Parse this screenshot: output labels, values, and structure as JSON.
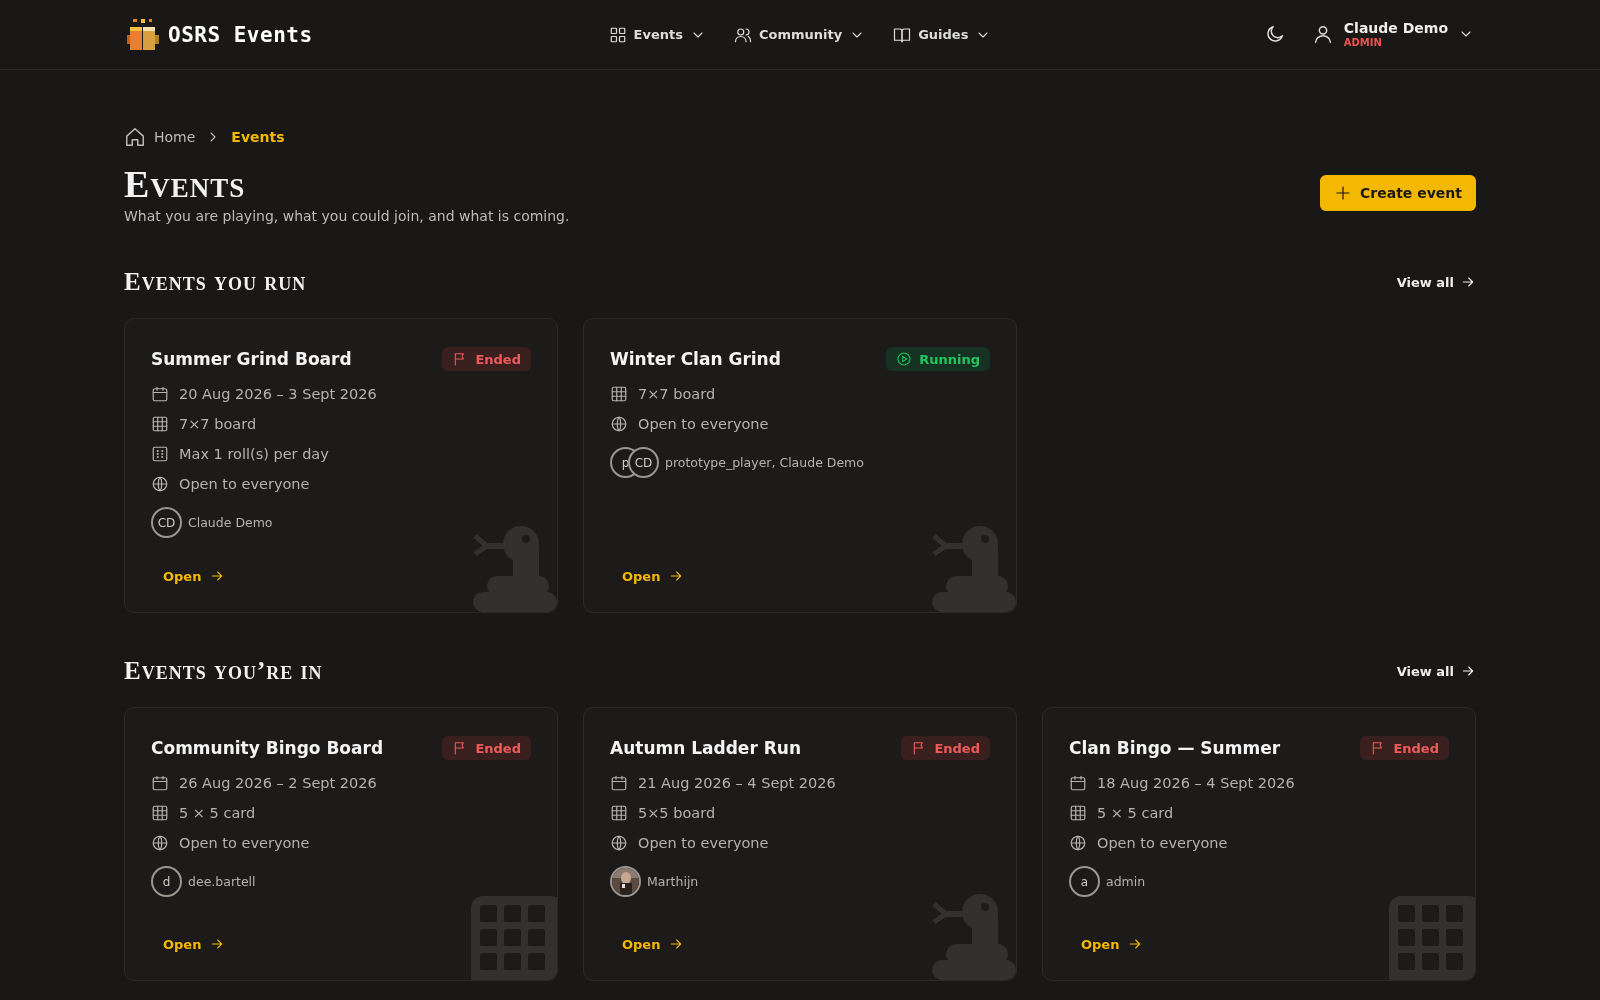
{
  "brand": {
    "name": "OSRS Events"
  },
  "nav": [
    {
      "label": "Events",
      "kind": "grid"
    },
    {
      "label": "Community",
      "kind": "users"
    },
    {
      "label": "Guides",
      "kind": "book"
    }
  ],
  "user": {
    "name": "Claude Demo",
    "role": "ADMIN"
  },
  "breadcrumb": [
    {
      "label": "Home",
      "selected": false
    },
    {
      "label": "Events",
      "selected": true
    }
  ],
  "page": {
    "title": "Events",
    "subtitle": "What you are playing, what you could join, and what is coming.",
    "action": "Create event"
  },
  "sections": [
    {
      "title": "Events you run",
      "link": "View all",
      "cards": [
        {
          "title": "Summer Grind Board",
          "status": {
            "kind": "ended",
            "label": "Ended"
          },
          "details": [
            {
              "kind": "date",
              "text": "20 Aug 2026 – 3 Sept 2026"
            },
            {
              "kind": "board",
              "text": "7×7 board"
            },
            {
              "kind": "rolls",
              "text": "Max 1 roll(s) per day"
            },
            {
              "kind": "access",
              "text": "Open to everyone"
            }
          ],
          "avatars": [
            {
              "kind": "initials",
              "text": "CD"
            }
          ],
          "people": "Claude Demo",
          "link": "Open",
          "art": {
            "kind": "snake"
          }
        },
        {
          "title": "Winter Clan Grind",
          "status": {
            "kind": "running",
            "label": "Running"
          },
          "details": [
            {
              "kind": "board",
              "text": "7×7 board"
            },
            {
              "kind": "access",
              "text": "Open to everyone"
            }
          ],
          "avatars": [
            {
              "kind": "initials",
              "text": "p"
            },
            {
              "kind": "initials",
              "text": "CD"
            }
          ],
          "people": "prototype_player, Claude Demo",
          "link": "Open",
          "art": {
            "kind": "snake"
          }
        }
      ]
    },
    {
      "title": "Events you’re in",
      "link": "View all",
      "cards": [
        {
          "title": "Community Bingo Board",
          "status": {
            "kind": "ended",
            "label": "Ended"
          },
          "details": [
            {
              "kind": "date",
              "text": "26 Aug 2026 – 2 Sept 2026"
            },
            {
              "kind": "board",
              "text": "5 × 5 card"
            },
            {
              "kind": "access",
              "text": "Open to everyone"
            }
          ],
          "avatars": [
            {
              "kind": "initials",
              "text": "d"
            }
          ],
          "people": "dee.bartell",
          "link": "Open",
          "art": {
            "kind": "grid"
          }
        },
        {
          "title": "Autumn Ladder Run",
          "status": {
            "kind": "ended",
            "label": "Ended"
          },
          "details": [
            {
              "kind": "date",
              "text": "21 Aug 2026 – 4 Sept 2026"
            },
            {
              "kind": "board",
              "text": "5×5 board"
            },
            {
              "kind": "access",
              "text": "Open to everyone"
            }
          ],
          "avatars": [
            {
              "kind": "picture"
            }
          ],
          "people": "Marthijn",
          "link": "Open",
          "art": {
            "kind": "snake"
          }
        },
        {
          "title": "Clan Bingo — Summer",
          "status": {
            "kind": "ended",
            "label": "Ended"
          },
          "details": [
            {
              "kind": "date",
              "text": "18 Aug 2026 – 4 Sept 2026"
            },
            {
              "kind": "board",
              "text": "5 × 5 card"
            },
            {
              "kind": "access",
              "text": "Open to everyone"
            }
          ],
          "avatars": [
            {
              "kind": "initials",
              "text": "a"
            }
          ],
          "people": "admin",
          "link": "Open",
          "art": {
            "kind": "grid"
          }
        }
      ]
    }
  ]
}
